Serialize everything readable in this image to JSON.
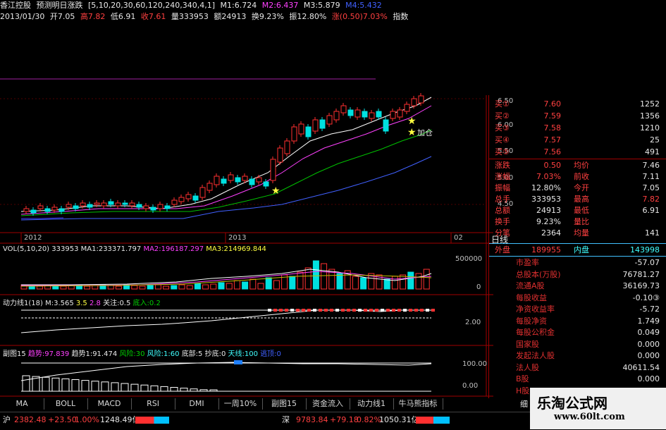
{
  "header": {
    "name": "香江控股",
    "indicator": "预测明日涨跌",
    "params": "[5,10,20,30,60,120,240,340,4,1]",
    "m1": "M1:6.724",
    "m2": "M2:6.437",
    "m3": "M3:5.879",
    "m4": "M4:5.432",
    "date": "2013/01/30",
    "open": "开7.05",
    "high": "高7.82",
    "low": "低6.91",
    "close": "收7.61",
    "volume": "量333953",
    "amount": "额24913",
    "turnover": "换9.23%",
    "amplitude": "振12.80%",
    "change": "涨(0.50)7.03%",
    "more": "指数"
  },
  "price_axis": [
    "6.50",
    "6.00",
    "5.50",
    "5.00",
    "4.50"
  ],
  "date_axis": [
    "2012",
    "2013",
    "02"
  ],
  "annotations": {
    "add_position": "加仓"
  },
  "vol_panel": {
    "title": "VOL(5,10,20) 333953",
    "ma1": "MA1:233371.797",
    "ma2": "MA2:196187.297",
    "ma3": "MA3:214969.844",
    "axis": [
      "500000",
      "0"
    ]
  },
  "power_panel": {
    "title": "动力线1(18)",
    "m": "M:3.565",
    "v1": "3.5",
    "v2": "2.8",
    "watch": "关注:0.5",
    "buy": "底入:0.2",
    "axis": [
      "2.00"
    ]
  },
  "sub_panel": {
    "title": "副图15",
    "trend": "趋势:97.839",
    "trend1": "趋势1:91.474",
    "risk30": "风险:30",
    "risk60": "风险:1:60",
    "bottom": "底部:5",
    "bottom_buy": "抄底:0",
    "sky": "天线:100",
    "escape": "逃顶:0",
    "axis": [
      "100.00",
      "0.00"
    ]
  },
  "tabs": [
    "MA",
    "BOLL",
    "MACD",
    "RSI",
    "DMI",
    "一周10%",
    "副图15",
    "资金流入",
    "动力线1",
    "牛马熊指标"
  ],
  "right_tab": "日线",
  "right_tab2": "细",
  "order_book": [
    {
      "label": "买①",
      "price": "7.60",
      "vol": "1252"
    },
    {
      "label": "买②",
      "price": "7.59",
      "vol": "1356"
    },
    {
      "label": "买③",
      "price": "7.58",
      "vol": "1210"
    },
    {
      "label": "买④",
      "price": "7.57",
      "vol": "25"
    },
    {
      "label": "买⑤",
      "price": "7.56",
      "vol": "491"
    }
  ],
  "quote": [
    {
      "l1": "涨跌",
      "v1": "0.50",
      "l2": "均价",
      "v2": "7.46"
    },
    {
      "l1": "涨幅",
      "v1": "7.03%",
      "l2": "前收",
      "v2": "7.11"
    },
    {
      "l1": "振幅",
      "v1": "12.80%",
      "l2": "今开",
      "v2": "7.05"
    },
    {
      "l1": "总手",
      "v1": "333953",
      "l2": "最高",
      "v2": "7.82"
    },
    {
      "l1": "总额",
      "v1": "24913",
      "l2": "最低",
      "v2": "6.91"
    },
    {
      "l1": "换手",
      "v1": "9.23%",
      "l2": "量比",
      "v2": ""
    },
    {
      "l1": "分笔",
      "v1": "2364",
      "l2": "均量",
      "v2": "141"
    }
  ],
  "outer_inner": {
    "outer_label": "外盘",
    "outer": "189955",
    "inner_label": "内盘",
    "inner": "143998"
  },
  "fundamentals": [
    {
      "label": "市盈率",
      "value": "-57.07"
    },
    {
      "label": "总股本(万股)",
      "value": "76781.27"
    },
    {
      "label": "流通A股",
      "value": "36169.73"
    },
    {
      "label": "每股收益",
      "value": "-0.10③"
    },
    {
      "label": "净资收益率",
      "value": "-5.72"
    },
    {
      "label": "每股净资",
      "value": "1.749"
    },
    {
      "label": "每股公积金",
      "value": "0.049"
    },
    {
      "label": "国家股",
      "value": "0.000"
    },
    {
      "label": "发起法人股",
      "value": "0.000"
    },
    {
      "label": "法人股",
      "value": "40611.54"
    },
    {
      "label": "B股",
      "value": "0.000"
    },
    {
      "label": "H股",
      "value": "0.000"
    }
  ],
  "status": {
    "sh_label": "沪",
    "sh_index": "2382.48",
    "sh_change": "+23.50",
    "sh_pct": "1.00%",
    "sh_amount": "1248.49亿",
    "sz_label": "深",
    "sz_index": "9783.84",
    "sz_change": "+79.18",
    "sz_pct": "0.82%",
    "sz_amount": "1050.31亿"
  },
  "watermark": {
    "line1": "乐淘公式网",
    "line2": "www.60lt.com"
  },
  "colors": {
    "up": "#ff3030",
    "down": "#00e0e0",
    "ma1": "#ffffff",
    "ma2": "#ff40ff",
    "ma3": "#00c000",
    "ma4": "#4060ff"
  }
}
